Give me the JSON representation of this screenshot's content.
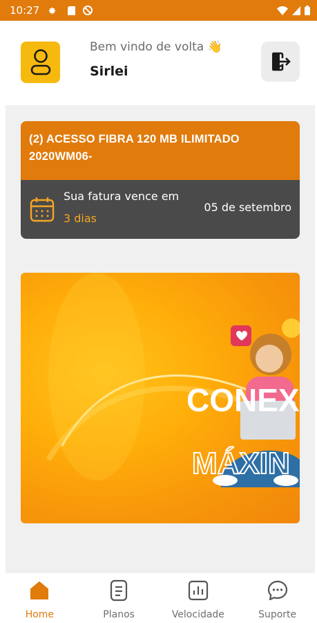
{
  "status_bar": {
    "time": "10:27"
  },
  "header": {
    "welcome": "Bem vindo de volta 👋",
    "username": "Sirlei"
  },
  "contract": {
    "title": "(2) ACESSO FIBRA  120 MB  ILIMITADO 2020WM06-",
    "due_label": "Sua fatura vence em",
    "due_days": "3 dias",
    "due_date": "05 de setembro"
  },
  "banner": {
    "headline_top": "CONEX",
    "headline_bottom": "MÁXIN"
  },
  "nav": {
    "items": [
      {
        "label": "Home",
        "icon": "home-icon",
        "active": true
      },
      {
        "label": "Planos",
        "icon": "document-icon",
        "active": false
      },
      {
        "label": "Velocidade",
        "icon": "chart-icon",
        "active": false
      },
      {
        "label": "Suporte",
        "icon": "chat-icon",
        "active": false
      }
    ]
  },
  "colors": {
    "accent": "#e07b0c",
    "dark": "#4a4a4a",
    "highlight": "#f5a623",
    "avatar_bg": "#f6b90e"
  }
}
